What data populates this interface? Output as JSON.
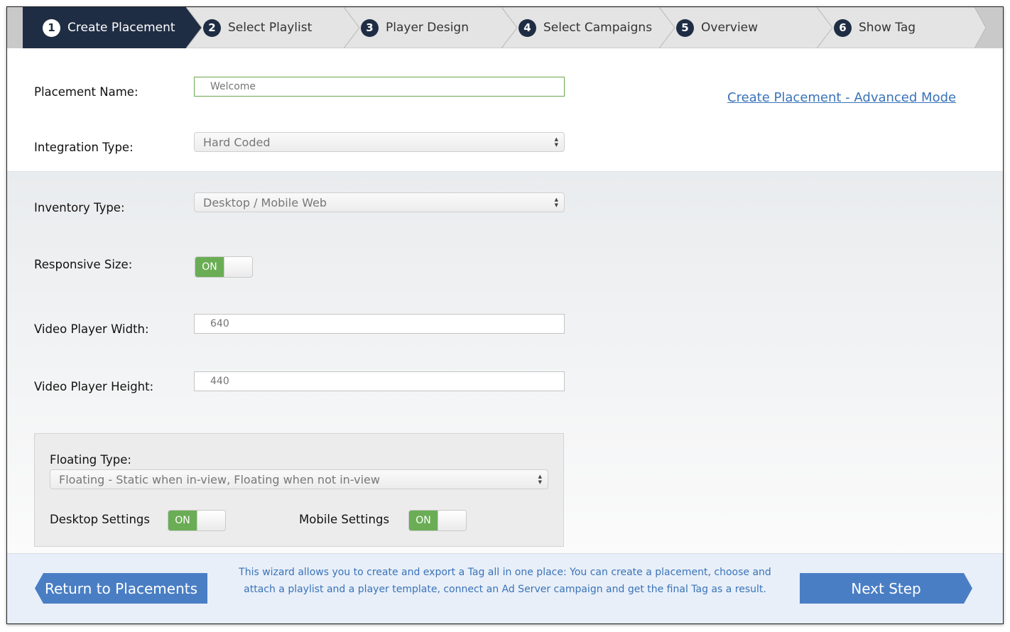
{
  "steps": [
    {
      "num": "1",
      "label": "Create Placement",
      "active": true
    },
    {
      "num": "2",
      "label": "Select Playlist",
      "active": false
    },
    {
      "num": "3",
      "label": "Player Design",
      "active": false
    },
    {
      "num": "4",
      "label": "Select Campaigns",
      "active": false
    },
    {
      "num": "5",
      "label": "Overview",
      "active": false
    },
    {
      "num": "6",
      "label": "Show Tag",
      "active": false
    }
  ],
  "form": {
    "placement_name": {
      "label": "Placement Name:",
      "value": "",
      "placeholder": "Welcome"
    },
    "advanced_link": "Create Placement - Advanced Mode",
    "integration_type": {
      "label": "Integration Type:",
      "value": "Hard Coded"
    },
    "inventory_type": {
      "label": "Inventory Type:",
      "value": "Desktop / Mobile Web"
    },
    "responsive_size": {
      "label": "Responsive Size:",
      "state": "ON"
    },
    "video_width": {
      "label": "Video Player Width:",
      "placeholder": "640"
    },
    "video_height": {
      "label": "Video Player Height:",
      "placeholder": "440"
    },
    "floating": {
      "label": "Floating Type:",
      "value": "Floating - Static when in-view, Floating when not in-view",
      "desktop": {
        "label": "Desktop Settings",
        "state": "ON"
      },
      "mobile": {
        "label": "Mobile Settings",
        "state": "ON"
      }
    }
  },
  "footer": {
    "back_label": "Return to Placements",
    "next_label": "Next Step",
    "info_text": "This wizard allows you to create and export a Tag all in one place: You can create a placement, choose and attach a playlist and a player template, connect an Ad Server campaign and get the final Tag as a result."
  },
  "colors": {
    "active_step": "#1f2d44",
    "inactive_step": "#e4e4e4",
    "toggle_on": "#6aad55",
    "button": "#4a7ec4",
    "link": "#3a73b8"
  }
}
